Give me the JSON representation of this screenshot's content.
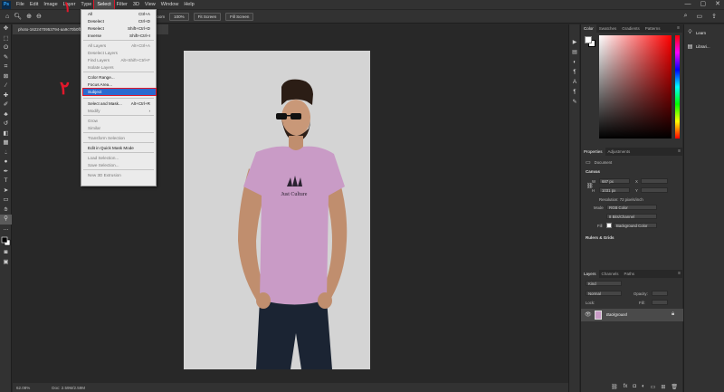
{
  "app": {
    "logo": "Ps"
  },
  "menubar": {
    "items": [
      "File",
      "Edit",
      "Image",
      "Layer",
      "Type",
      "Select",
      "Filter",
      "3D",
      "View",
      "Window",
      "Help"
    ],
    "active": "Select",
    "window_controls": [
      "—",
      "▢",
      "✕"
    ]
  },
  "options_bar": {
    "scrubby_zoom_label": "Scrubby Zoom",
    "zoom_100_label": "100%",
    "fit_screen_label": "Fit Screen",
    "fill_screen_label": "Fill Screen"
  },
  "document": {
    "tab_title": "photo-1622470953794-aa9c70b0fb9d.jpg @ 62.1% (RGB/8*)",
    "status_zoom": "62.08%",
    "status_doc": "Doc: 2.59M/2.59M"
  },
  "select_menu": {
    "items": [
      {
        "label": "All",
        "shortcut": "Ctrl+A",
        "disabled": false
      },
      {
        "label": "Deselect",
        "shortcut": "Ctrl+D",
        "disabled": false
      },
      {
        "label": "Reselect",
        "shortcut": "Shift+Ctrl+D",
        "disabled": false
      },
      {
        "label": "Inverse",
        "shortcut": "Shift+Ctrl+I",
        "disabled": false
      },
      {
        "label": "All Layers",
        "shortcut": "Alt+Ctrl+A",
        "disabled": true
      },
      {
        "label": "Deselect Layers",
        "shortcut": "",
        "disabled": true
      },
      {
        "label": "Find Layers",
        "shortcut": "Alt+Shift+Ctrl+F",
        "disabled": true
      },
      {
        "label": "Isolate Layers",
        "shortcut": "",
        "disabled": true
      },
      {
        "label": "Color Range...",
        "shortcut": "",
        "disabled": false
      },
      {
        "label": "Focus Area...",
        "shortcut": "",
        "disabled": false
      },
      {
        "label": "Subject",
        "shortcut": "",
        "disabled": false,
        "highlighted": true
      },
      {
        "label": "Select and Mask...",
        "shortcut": "Alt+Ctrl+R",
        "disabled": false
      },
      {
        "label": "Modify",
        "shortcut": "",
        "disabled": true,
        "submenu": true
      },
      {
        "label": "Grow",
        "shortcut": "",
        "disabled": true
      },
      {
        "label": "Similar",
        "shortcut": "",
        "disabled": true
      },
      {
        "label": "Transform Selection",
        "shortcut": "",
        "disabled": true
      },
      {
        "label": "Edit in Quick Mask Mode",
        "shortcut": "",
        "disabled": false
      },
      {
        "label": "Load Selection...",
        "shortcut": "",
        "disabled": true
      },
      {
        "label": "Save Selection...",
        "shortcut": "",
        "disabled": true
      },
      {
        "label": "New 3D Extrusion",
        "shortcut": "",
        "disabled": true
      }
    ]
  },
  "annotations": {
    "step_1": "۱",
    "step_2": "۲",
    "color": "#e0182b"
  },
  "photo": {
    "shirt_print_text": "Just Culture",
    "background": "#d4d4d4",
    "shirt_color": "#c99bc6"
  },
  "color_panel": {
    "tabs": [
      "Color",
      "Swatches",
      "Gradients",
      "Patterns"
    ]
  },
  "properties_panel": {
    "tabs": [
      "Properties",
      "Adjustments"
    ],
    "document_label": "Document",
    "canvas_heading": "Canvas",
    "w_label": "W",
    "w_value": "687 px",
    "h_label": "H",
    "h_value": "1031 px",
    "x_label": "X",
    "y_label": "Y",
    "resolution": "Resolution: 72 pixels/inch",
    "mode_label": "Mode",
    "mode_value": "RGB Color",
    "depth_value": "8 Bits/Channel",
    "fill_label": "Fill",
    "fill_value": "Background Color",
    "rulers_heading": "Rulers & Grids"
  },
  "layers_panel": {
    "tabs": [
      "Layers",
      "Channels",
      "Paths"
    ],
    "kind_placeholder": "Kind",
    "blend_mode": "Normal",
    "opacity_label": "Opacity:",
    "lock_label": "Lock:",
    "fill_label": "Fill:",
    "layer_name": "Background"
  },
  "learn_panel": {
    "learn_label": "Learn",
    "libraries_label": "Librari..."
  }
}
